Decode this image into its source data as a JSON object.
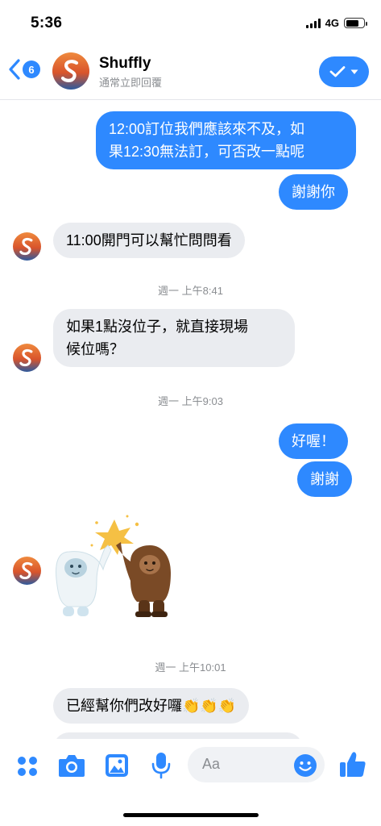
{
  "status_bar": {
    "time": "5:36",
    "network": "4G",
    "battery_level": 0.75
  },
  "header": {
    "unread_count": "6",
    "contact_name": "Shuffly",
    "contact_status": "通常立即回覆",
    "done_icon": "check-icon",
    "back_icon": "chevron-left-icon"
  },
  "colors": {
    "accent": "#2e89ff",
    "incoming_bubble": "#eaecf0",
    "timestamp": "#8a8d91"
  },
  "messages": [
    {
      "direction": "out",
      "text": "12:00訂位我們應該來不及，如\n果12:30無法訂，可否改一點呢"
    },
    {
      "direction": "out",
      "text": "謝謝你"
    },
    {
      "direction": "in",
      "text": "11:00開門可以幫忙問問看"
    },
    {
      "type": "timestamp",
      "text": "週一 上午8:41"
    },
    {
      "direction": "in",
      "text": "如果1點沒位子，就直接現場\n候位嗎？"
    },
    {
      "type": "timestamp",
      "text": "週一 上午9:03"
    },
    {
      "direction": "out",
      "text": "好喔！"
    },
    {
      "direction": "out",
      "text": "謝謝"
    },
    {
      "direction": "in",
      "type": "sticker",
      "sticker": "yeti-bigfoot-high-five-sticker"
    },
    {
      "type": "timestamp",
      "text": "週一 上午10:01"
    },
    {
      "direction": "in",
      "text": "已經幫你們改好囉👏👏👏"
    }
  ],
  "composer": {
    "placeholder": "Aa",
    "icons": [
      "menu-dots-icon",
      "camera-icon",
      "gallery-icon",
      "microphone-icon",
      "emoji-icon",
      "thumbs-up-icon"
    ]
  }
}
